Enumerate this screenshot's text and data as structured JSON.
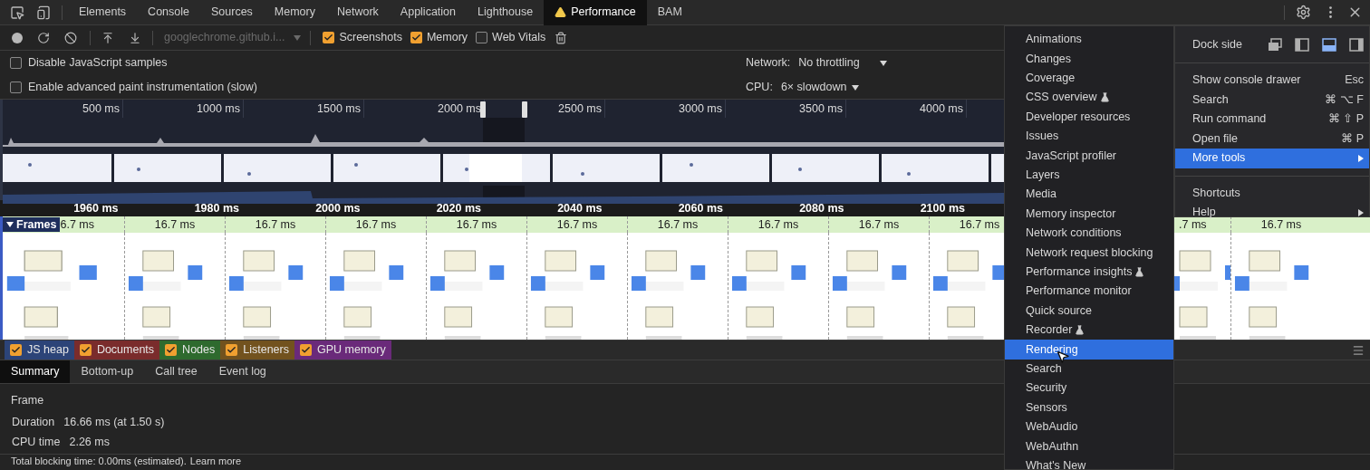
{
  "tabs": [
    {
      "label": "Elements",
      "selected": false,
      "warning": false
    },
    {
      "label": "Console",
      "selected": false,
      "warning": false
    },
    {
      "label": "Sources",
      "selected": false,
      "warning": false
    },
    {
      "label": "Memory",
      "selected": false,
      "warning": false
    },
    {
      "label": "Network",
      "selected": false,
      "warning": false
    },
    {
      "label": "Application",
      "selected": false,
      "warning": false
    },
    {
      "label": "Lighthouse",
      "selected": false,
      "warning": false
    },
    {
      "label": "Performance",
      "selected": true,
      "warning": true
    },
    {
      "label": "BAM",
      "selected": false,
      "warning": false
    }
  ],
  "toolbar": {
    "url": {
      "text": "googlechrome.github.i...",
      "disabled": true
    },
    "options": [
      {
        "label": "Screenshots",
        "checked": true
      },
      {
        "label": "Memory",
        "checked": true
      },
      {
        "label": "Web Vitals",
        "checked": false
      }
    ]
  },
  "settings": {
    "checkboxes": [
      {
        "label": "Disable JavaScript samples",
        "checked": false
      },
      {
        "label": "Enable advanced paint instrumentation (slow)",
        "checked": false
      }
    ],
    "network": {
      "label": "Network:",
      "value": "No throttling"
    },
    "cpu": {
      "label": "CPU:",
      "value": "6× slowdown"
    }
  },
  "overview": {
    "ticks": [
      "500 ms",
      "1000 ms",
      "1500 ms",
      "2000 ms",
      "2500 ms",
      "3000 ms",
      "3500 ms",
      "4000 ms"
    ]
  },
  "timeline": {
    "ticks": [
      "1960 ms",
      "1980 ms",
      "2000 ms",
      "2020 ms",
      "2040 ms",
      "2060 ms",
      "2080 ms",
      "2100 ms"
    ],
    "frames": {
      "label": "Frames",
      "expanded": true,
      "durations": [
        "6.7 ms",
        "16.7 ms",
        "16.7 ms",
        "16.7 ms",
        "16.7 ms",
        "16.7 ms",
        "16.7 ms",
        "16.7 ms",
        "16.7 ms",
        "16.7 ms"
      ],
      "durations_past_menu": [
        ".7 ms",
        "16.7 ms"
      ]
    }
  },
  "counters": [
    {
      "label": "JS heap",
      "checked": true,
      "color": "#2c4478"
    },
    {
      "label": "Documents",
      "checked": true,
      "color": "#7a2c2c"
    },
    {
      "label": "Nodes",
      "checked": true,
      "color": "#2e6a2e"
    },
    {
      "label": "Listeners",
      "checked": true,
      "color": "#72521e"
    },
    {
      "label": "GPU memory",
      "checked": true,
      "color": "#6a2a7a"
    }
  ],
  "details": {
    "tabs": [
      {
        "label": "Summary",
        "selected": true
      },
      {
        "label": "Bottom-up",
        "selected": false
      },
      {
        "label": "Call tree",
        "selected": false
      },
      {
        "label": "Event log",
        "selected": false
      }
    ],
    "summary": {
      "title": "Frame",
      "rows": [
        {
          "label": "Duration",
          "value": "16.66 ms (at 1.50 s)"
        },
        {
          "label": "CPU time",
          "value": "2.26 ms"
        }
      ],
      "footer": "Total blocking time: 0.00ms (estimated).",
      "link": "Learn more"
    }
  },
  "main_menu": {
    "dock_side": {
      "label": "Dock side",
      "options": [
        {
          "kind": "undock",
          "selected": false
        },
        {
          "kind": "left",
          "selected": false
        },
        {
          "kind": "bottom",
          "selected": true
        },
        {
          "kind": "right",
          "selected": false
        }
      ]
    },
    "groups": [
      [
        {
          "label": "Show console drawer",
          "shortcut": "Esc",
          "submenu": false,
          "selected": false
        },
        {
          "label": "Search",
          "shortcut": "⌘ ⌥ F",
          "submenu": false,
          "selected": false
        },
        {
          "label": "Run command",
          "shortcut": "⌘ ⇧ P",
          "submenu": false,
          "selected": false
        },
        {
          "label": "Open file",
          "shortcut": "⌘ P",
          "submenu": false,
          "selected": false
        },
        {
          "label": "More tools",
          "submenu": true,
          "selected": true
        }
      ],
      [
        {
          "label": "Shortcuts",
          "submenu": false,
          "selected": false
        },
        {
          "label": "Help",
          "submenu": true,
          "selected": false
        }
      ]
    ]
  },
  "more_tools": [
    {
      "label": "Animations",
      "experimental": false,
      "selected": false
    },
    {
      "label": "Changes",
      "experimental": false,
      "selected": false
    },
    {
      "label": "Coverage",
      "experimental": false,
      "selected": false
    },
    {
      "label": "CSS overview",
      "experimental": true,
      "selected": false
    },
    {
      "label": "Developer resources",
      "experimental": false,
      "selected": false
    },
    {
      "label": "Issues",
      "experimental": false,
      "selected": false
    },
    {
      "label": "JavaScript profiler",
      "experimental": false,
      "selected": false
    },
    {
      "label": "Layers",
      "experimental": false,
      "selected": false
    },
    {
      "label": "Media",
      "experimental": false,
      "selected": false
    },
    {
      "label": "Memory inspector",
      "experimental": false,
      "selected": false
    },
    {
      "label": "Network conditions",
      "experimental": false,
      "selected": false
    },
    {
      "label": "Network request blocking",
      "experimental": false,
      "selected": false
    },
    {
      "label": "Performance insights",
      "experimental": true,
      "selected": false
    },
    {
      "label": "Performance monitor",
      "experimental": false,
      "selected": false
    },
    {
      "label": "Quick source",
      "experimental": false,
      "selected": false
    },
    {
      "label": "Recorder",
      "experimental": true,
      "selected": false
    },
    {
      "label": "Rendering",
      "experimental": false,
      "selected": true
    },
    {
      "label": "Search",
      "experimental": false,
      "selected": false
    },
    {
      "label": "Security",
      "experimental": false,
      "selected": false
    },
    {
      "label": "Sensors",
      "experimental": false,
      "selected": false
    },
    {
      "label": "WebAudio",
      "experimental": false,
      "selected": false
    },
    {
      "label": "WebAuthn",
      "experimental": false,
      "selected": false
    },
    {
      "label": "What's New",
      "experimental": false,
      "selected": false
    }
  ]
}
